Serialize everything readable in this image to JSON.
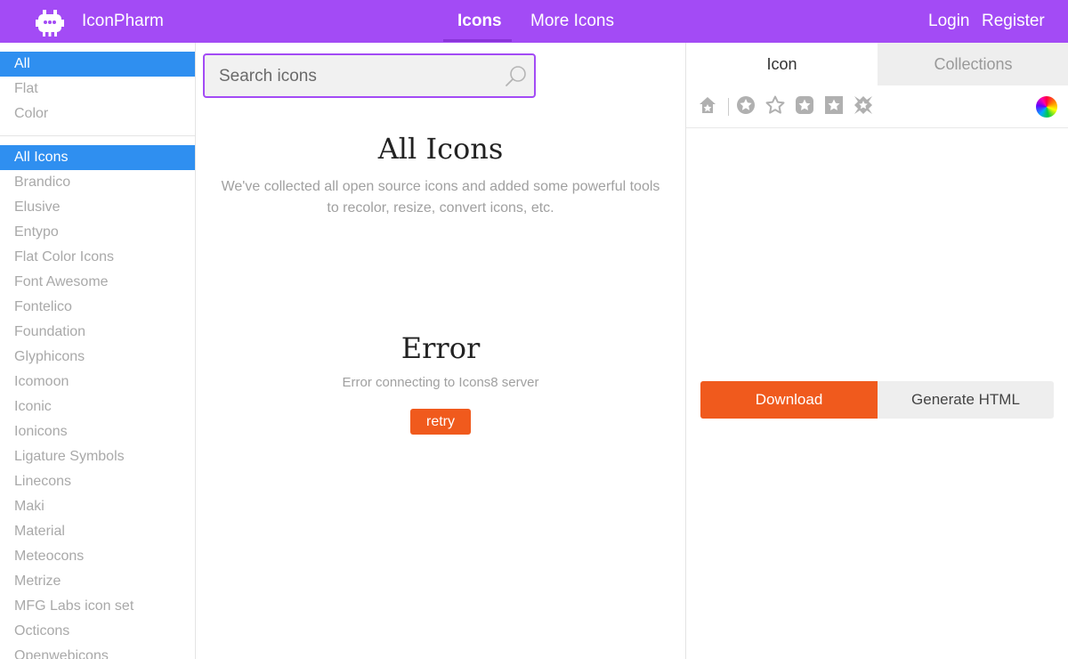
{
  "header": {
    "brand": "IconPharm",
    "tabs": [
      {
        "label": "Icons",
        "active": true
      },
      {
        "label": "More Icons",
        "active": false
      }
    ],
    "login": "Login",
    "register": "Register",
    "colors": {
      "bg": "#a34bf5",
      "underline": "#8a35d9"
    }
  },
  "sidebar": {
    "filters": [
      {
        "label": "All",
        "active": true
      },
      {
        "label": "Flat",
        "active": false
      },
      {
        "label": "Color",
        "active": false
      }
    ],
    "collections": [
      {
        "label": "All Icons",
        "active": true
      },
      {
        "label": "Brandico"
      },
      {
        "label": "Elusive"
      },
      {
        "label": "Entypo"
      },
      {
        "label": "Flat Color Icons"
      },
      {
        "label": "Font Awesome"
      },
      {
        "label": "Fontelico"
      },
      {
        "label": "Foundation"
      },
      {
        "label": "Glyphicons"
      },
      {
        "label": "Icomoon"
      },
      {
        "label": "Iconic"
      },
      {
        "label": "Ionicons"
      },
      {
        "label": "Ligature Symbols"
      },
      {
        "label": "Linecons"
      },
      {
        "label": "Maki"
      },
      {
        "label": "Material"
      },
      {
        "label": "Meteocons"
      },
      {
        "label": "Metrize"
      },
      {
        "label": "MFG Labs icon set"
      },
      {
        "label": "Octicons"
      },
      {
        "label": "Openwebicons"
      }
    ],
    "active_color": "#2f8ff0"
  },
  "search": {
    "placeholder": "Search icons",
    "value": ""
  },
  "main": {
    "title": "All Icons",
    "description": "We've collected all open source icons and added some powerful tools to recolor, resize, convert icons, etc.",
    "error_title": "Error",
    "error_message": "Error connecting to Icons8 server",
    "retry_label": "retry"
  },
  "panel": {
    "tabs": [
      {
        "label": "Icon",
        "active": true
      },
      {
        "label": "Collections",
        "active": false
      }
    ],
    "tools": [
      "home-star-icon",
      "circle-star-icon",
      "star-outline-icon",
      "square-star-icon",
      "square-filled-star-icon",
      "burst-star-icon",
      "color-wheel-icon"
    ],
    "download_label": "Download",
    "generate_html_label": "Generate HTML",
    "accent": "#f05a1d"
  }
}
